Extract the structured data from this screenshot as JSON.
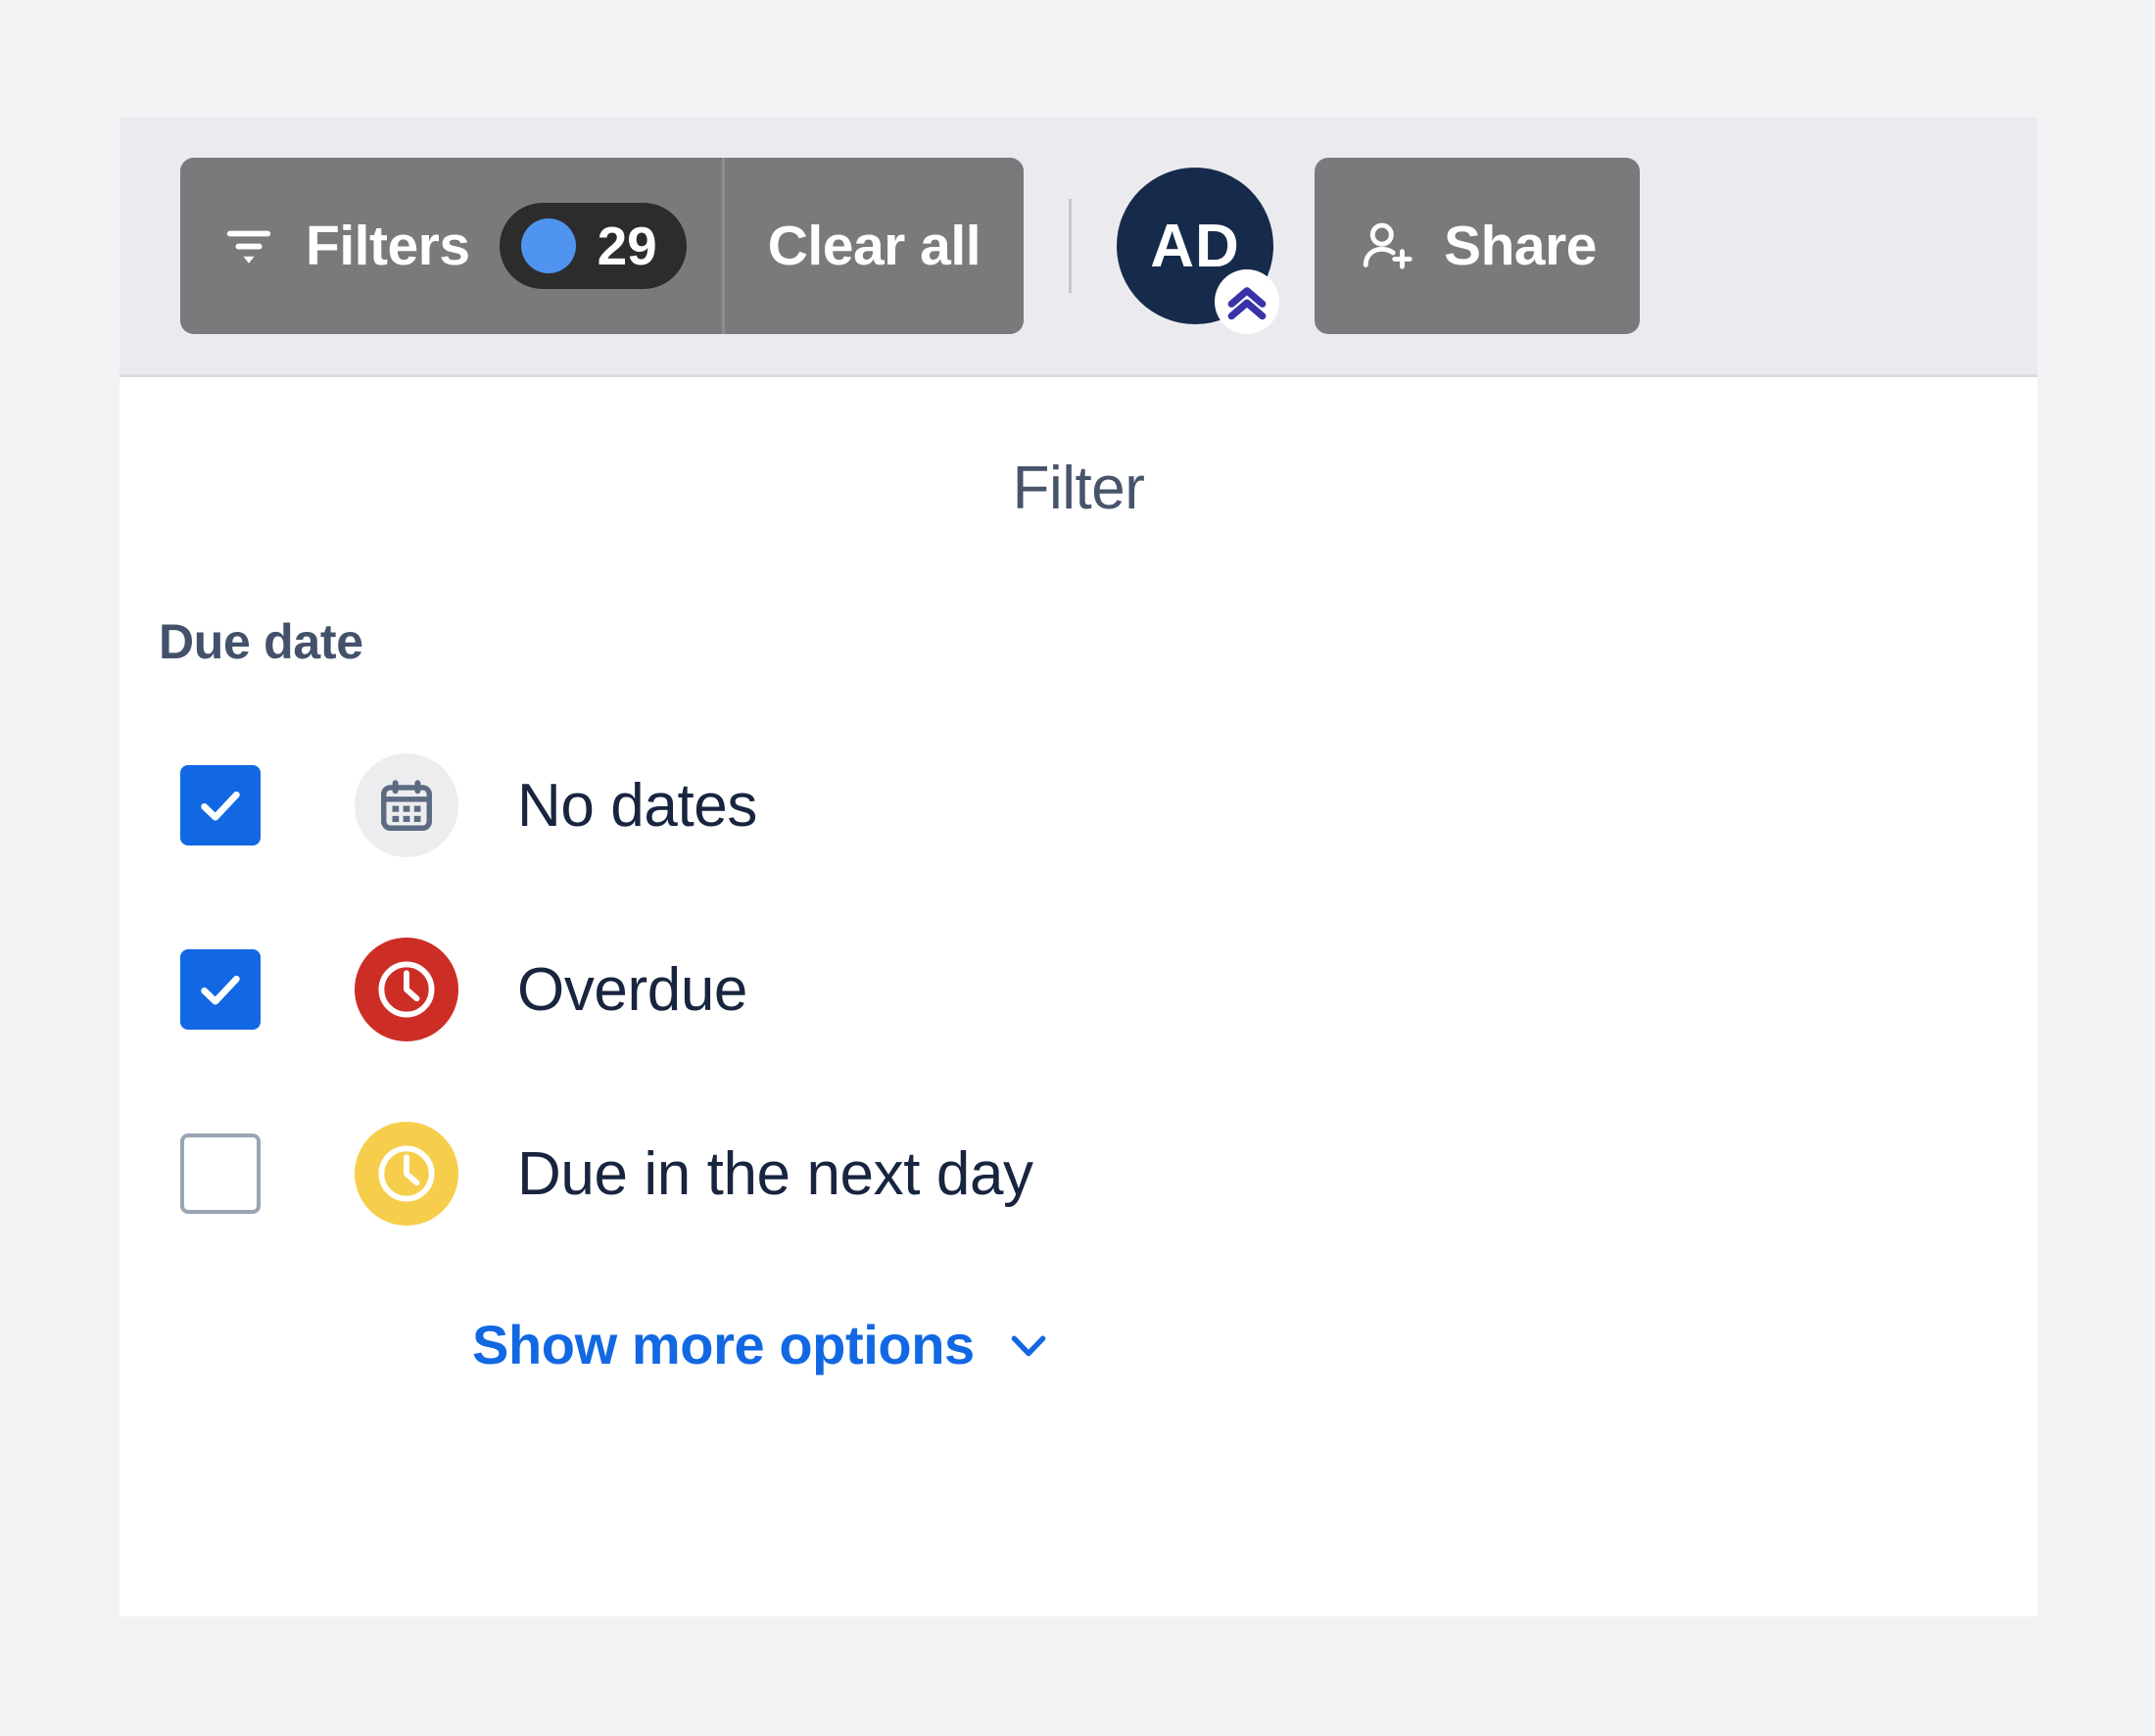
{
  "toolbar": {
    "filters": {
      "icon": "filter-icon",
      "label": "Filters",
      "count": "29",
      "count_dot_color": "#4F94F0",
      "pill_bg": "#2C2C2C"
    },
    "clear_all_label": "Clear all",
    "avatar": {
      "initials": "AD",
      "bg_color": "#162A4B",
      "badge_icon": "double-chevron-up-icon",
      "badge_color": "#3A33A8"
    },
    "share": {
      "icon": "person-add-icon",
      "label": "Share"
    },
    "button_bg": "#7A7A7D"
  },
  "panel": {
    "title": "Filter",
    "section_label": "Due date",
    "options": [
      {
        "label": "No dates",
        "checked": true,
        "icon": "calendar-icon",
        "icon_bg": "#EDEDEF",
        "icon_fg": "#5C6B82"
      },
      {
        "label": "Overdue",
        "checked": true,
        "icon": "clock-icon",
        "icon_bg": "#CC2E26",
        "icon_fg": "#FFFFFF"
      },
      {
        "label": "Due in the next day",
        "checked": false,
        "icon": "clock-icon",
        "icon_bg": "#F6CE4C",
        "icon_fg": "#FFFFFF"
      }
    ],
    "show_more_label": "Show more options",
    "show_more_icon": "chevron-down-icon",
    "link_color": "#1268E3",
    "checkbox_checked_color": "#1268E3"
  }
}
